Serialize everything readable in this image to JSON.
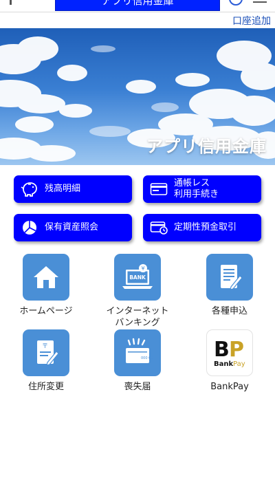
{
  "header": {
    "title": "アプリ信用金庫"
  },
  "add_account": "口座追加",
  "banner": {
    "title": "アプリ信用金庫"
  },
  "main_buttons": [
    {
      "label": "残高明細",
      "icon": "piggy-bank-icon"
    },
    {
      "label": "通帳レス",
      "label2": "利用手続き",
      "icon": "passbook-icon"
    },
    {
      "label": "保有資産照会",
      "icon": "pie-chart-icon"
    },
    {
      "label": "定期性預金取引",
      "icon": "time-deposit-icon"
    }
  ],
  "tiles": [
    {
      "label": "ホームページ",
      "icon": "home-icon"
    },
    {
      "label": "インターネット",
      "label2": "バンキング",
      "icon": "laptop-bank-icon"
    },
    {
      "label": "各種申込",
      "icon": "application-form-icon"
    },
    {
      "label": "住所変更",
      "icon": "address-change-icon"
    },
    {
      "label": "喪失届",
      "icon": "lost-passbook-icon"
    },
    {
      "label": "BankPay",
      "icon": "bankpay-logo-icon"
    }
  ],
  "bankpay_logo": {
    "letters": "BP",
    "text": "Bank Pay"
  },
  "colors": {
    "button_blue": "#0000ff",
    "tile_blue": "#4a8fd6",
    "link_blue": "#1a4fb8"
  }
}
